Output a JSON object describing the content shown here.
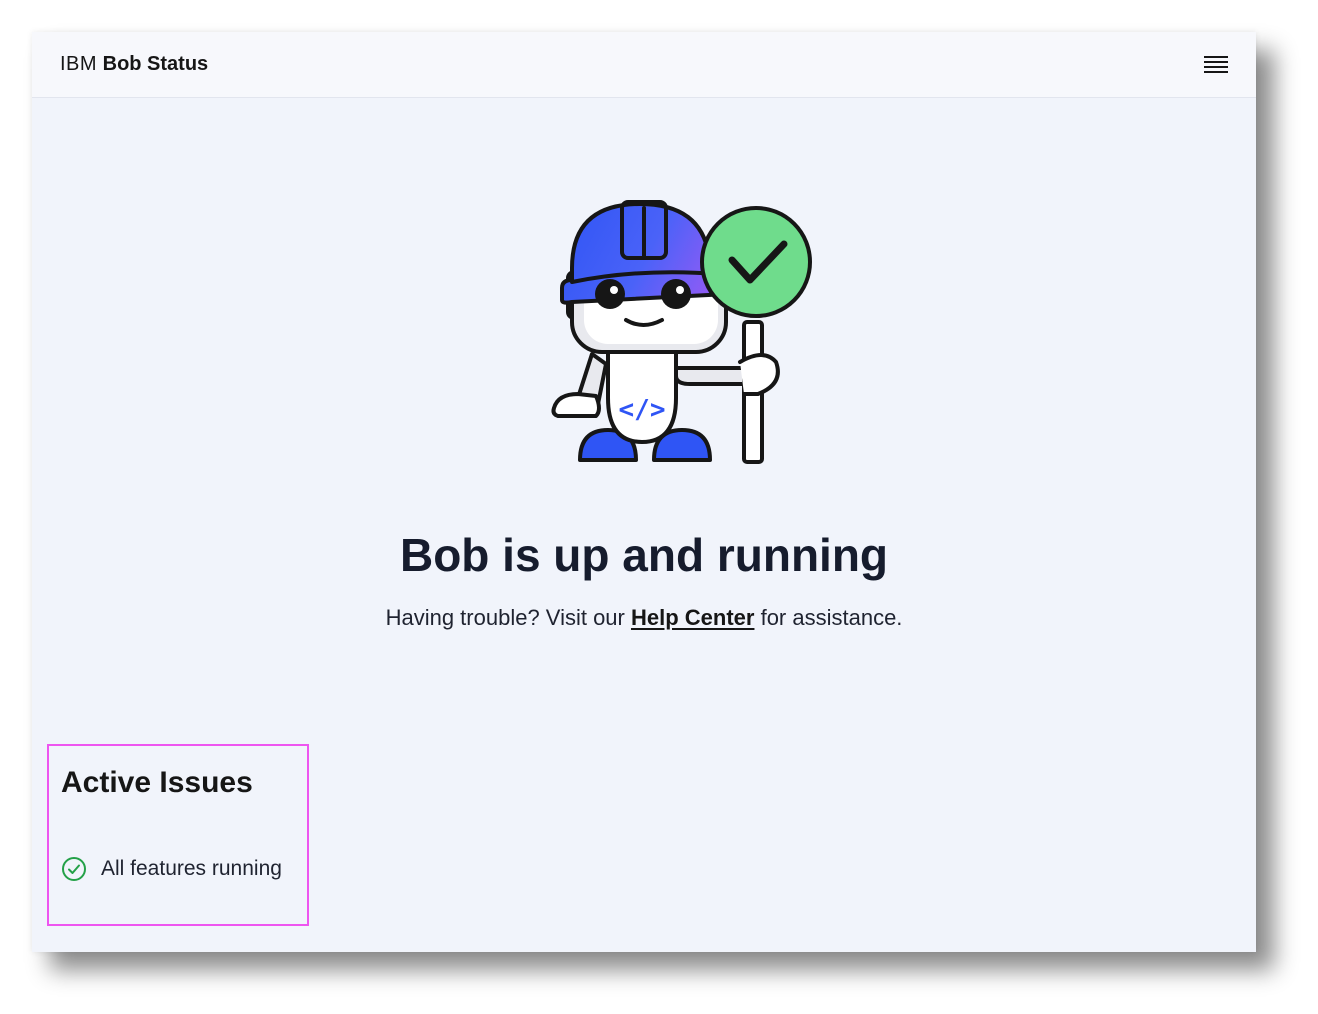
{
  "header": {
    "brand_company": "IBM",
    "brand_product": "Bob Status",
    "menu_icon": "hamburger-menu-icon"
  },
  "hero": {
    "illustration_icon": "robot-with-checkmark-sign-illustration",
    "code_glyph": "</>",
    "title": "Bob is up and running",
    "help_prefix": "Having trouble? Visit our ",
    "help_link": "Help Center",
    "help_suffix": " for assistance."
  },
  "issues": {
    "title": "Active Issues",
    "items": [
      {
        "icon": "check-circle-icon",
        "label": "All features running"
      }
    ]
  },
  "colors": {
    "background": "#f1f4fb",
    "header_bg": "#f7f8fc",
    "text_dark": "#161c2d",
    "helmet_blue": "#2f55f5",
    "helmet_purple": "#8a5cf5",
    "sign_green": "#6fdc8c",
    "status_green": "#24a148",
    "highlight_border": "#ee55f0"
  }
}
